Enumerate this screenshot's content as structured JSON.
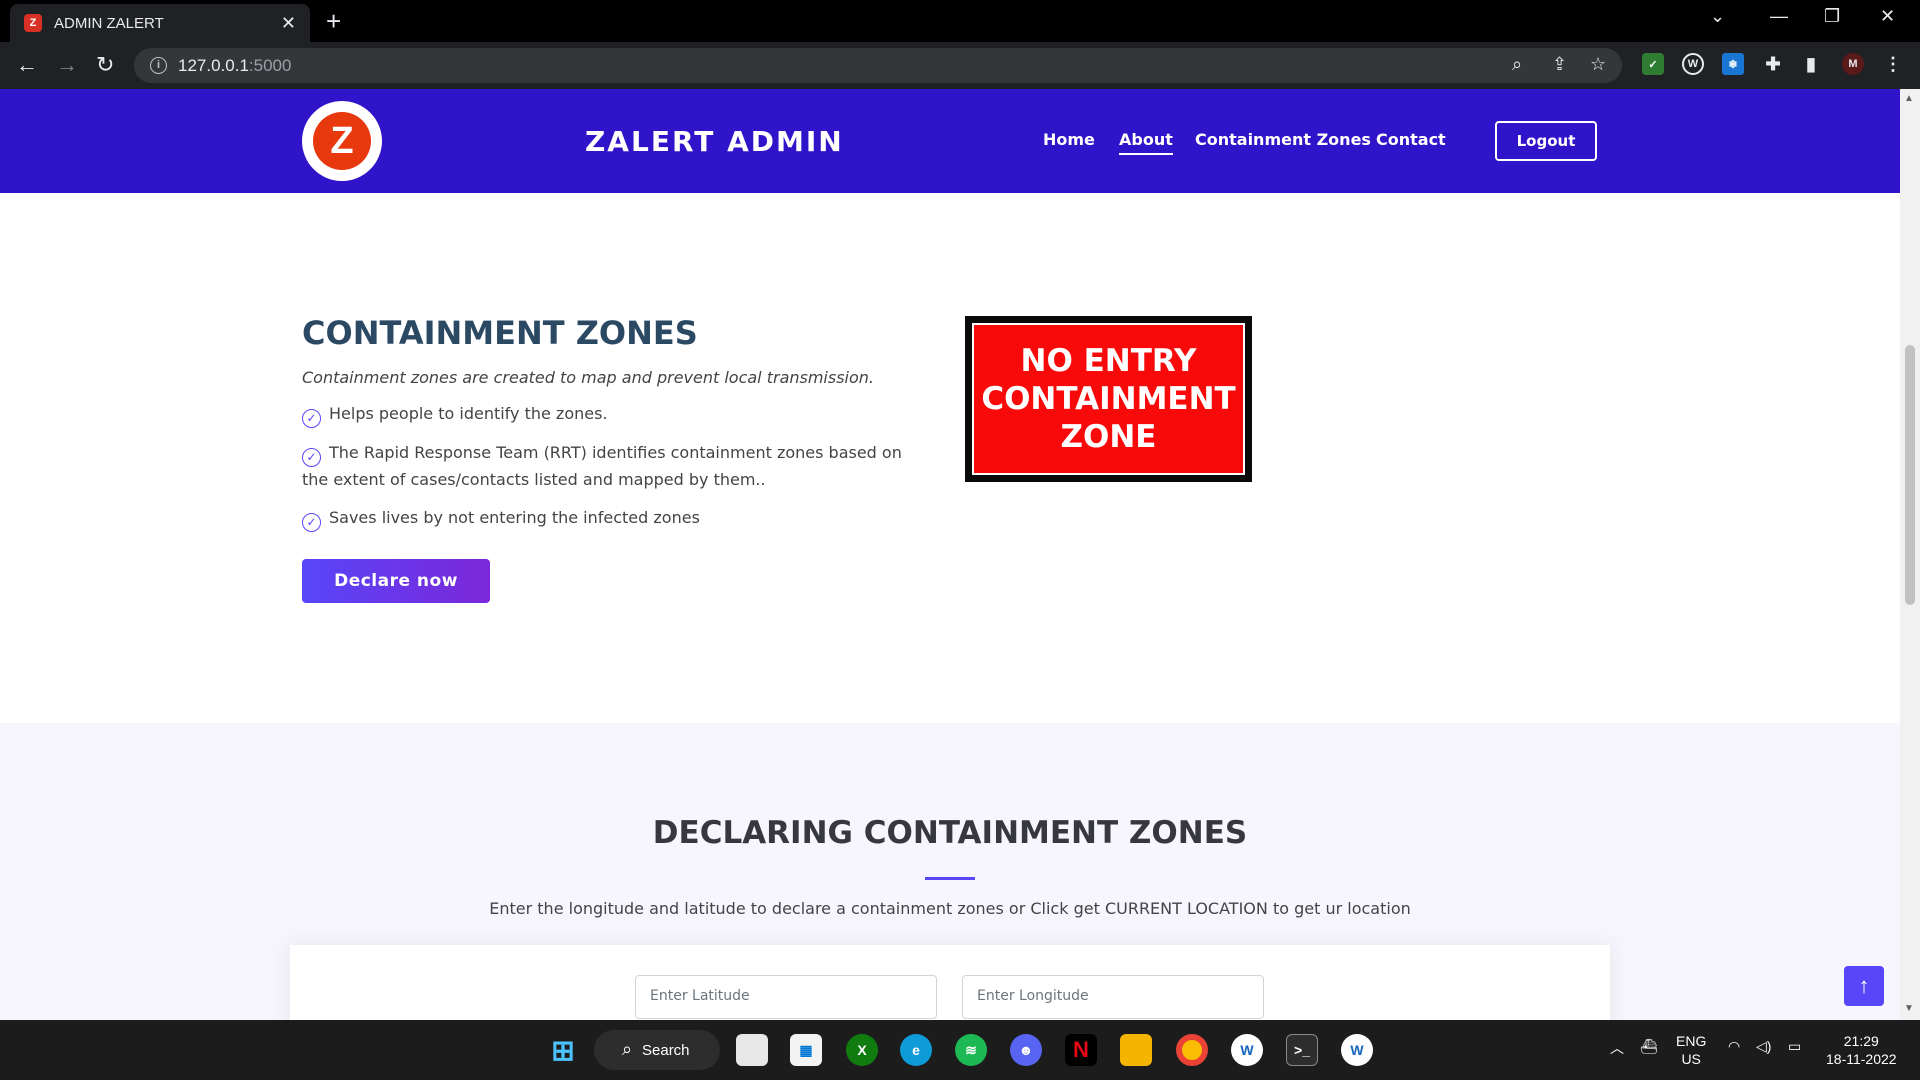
{
  "browser": {
    "tab_title": "ADMIN ZALERT",
    "tab_favicon": "Z",
    "url_host": "127.0.0.1",
    "url_port": ":5000"
  },
  "header": {
    "brand": "ZALERT ADMIN",
    "logo_letter": "Z",
    "nav": [
      "Home",
      "About",
      "Containment Zones",
      "Contact"
    ],
    "active_nav": "About",
    "logout_label": "Logout"
  },
  "about": {
    "title": "CONTAINMENT ZONES",
    "subtitle": "Containment zones are created to map and prevent local transmission.",
    "points": [
      "Helps people to identify the zones.",
      "The Rapid Response Team (RRT) identifies containment zones based on the extent of cases/contacts listed and mapped by them..",
      "Saves lives by not entering the infected zones"
    ],
    "cta_label": "Declare now",
    "sign_text": "NO ENTRY CONTAINMENT ZONE"
  },
  "declare": {
    "title": "DECLARING CONTAINMENT ZONES",
    "description": "Enter the longitude and latitude to declare a containment zones or Click get CURRENT LOCATION to get ur location",
    "latitude_placeholder": "Enter Latitude",
    "longitude_placeholder": "Enter Longitude"
  },
  "taskbar": {
    "search_label": "Search",
    "lang_line1": "ENG",
    "lang_line2": "US",
    "time": "21:29",
    "date": "18-11-2022"
  },
  "colors": {
    "header_bg": "#2f14c9",
    "accent": "#5846f9",
    "title": "#2c4964",
    "sign_red": "#f80a0a"
  }
}
